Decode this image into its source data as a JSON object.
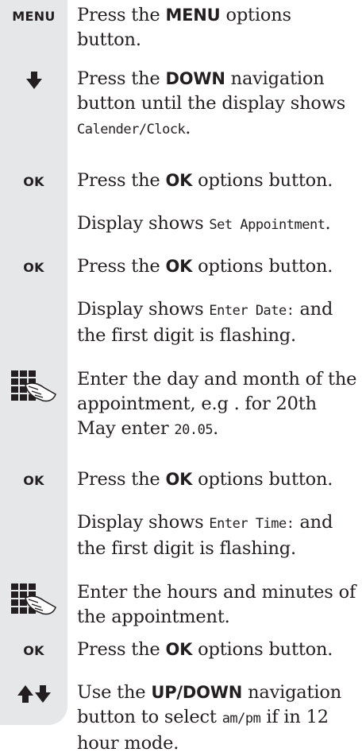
{
  "steps": [
    {
      "icon": "menu-key",
      "key": "MENU",
      "pre": "Press the ",
      "bold": "MENU",
      "post": " options button."
    },
    {
      "icon": "down-arrow-icon",
      "pre": "Press the ",
      "bold": "DOWN",
      "mid": " navigation button until the display shows ",
      "lcd": "Calender/Clock",
      "post": "."
    },
    {
      "icon": "ok-key",
      "key": "OK",
      "pre": "Press the ",
      "bold": "OK",
      "post": " options button."
    },
    {
      "pre": "Display shows ",
      "lcd": "Set Appointment",
      "post": "."
    },
    {
      "icon": "ok-key",
      "key": "OK",
      "pre": "Press the ",
      "bold": "OK",
      "post": " options button."
    },
    {
      "pre": "Display shows ",
      "lcd": "Enter Date:",
      "post": " and the first digit is flashing."
    },
    {
      "icon": "keypad-icon",
      "pre": "Enter the day and month of the appointment, e.g . for 20th May enter ",
      "lcd": "20.05",
      "post": "."
    },
    {
      "icon": "ok-key",
      "key": "OK",
      "pre": "Press the ",
      "bold": "OK",
      "post": " options button."
    },
    {
      "pre": "Display shows ",
      "lcd": "Enter Time:",
      "post": " and the first digit is flashing."
    },
    {
      "icon": "keypad-icon",
      "pre": "Enter the hours and minutes of the appointment."
    },
    {
      "icon": "ok-key",
      "key": "OK",
      "pre": "Press the ",
      "bold": "OK",
      "post": " options button."
    },
    {
      "icon": "up-down-arrow-icon",
      "pre": "Use the ",
      "bold": "UP/DOWN",
      "mid": " navigation button to select ",
      "lcd": "am/pm",
      "post": " if in 12 hour mode."
    }
  ]
}
